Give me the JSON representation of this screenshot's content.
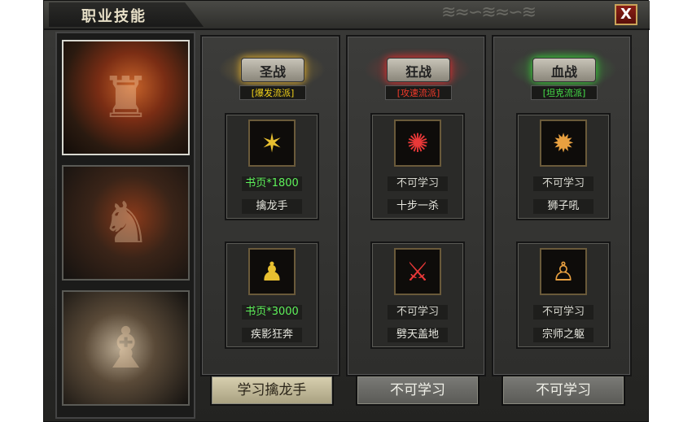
{
  "window": {
    "title": "职业技能",
    "close_label": "X"
  },
  "columns": [
    {
      "name": "圣战",
      "style": "[爆发流派]",
      "glow": "#e8b430",
      "style_color": "#f2d21a",
      "skills": [
        {
          "icon": "claw-icon",
          "cost": "书页*1800",
          "name": "擒龙手",
          "learnable": true
        },
        {
          "icon": "dash-icon",
          "cost": "书页*3000",
          "name": "疾影狂奔",
          "learnable": true
        }
      ],
      "button": "学习擒龙手"
    },
    {
      "name": "狂战",
      "style": "[攻速流派]",
      "glow": "#e83030",
      "style_color": "#f23a2a",
      "skills": [
        {
          "icon": "swirl-icon",
          "cost": "不可学习",
          "name": "十步一杀",
          "learnable": false
        },
        {
          "icon": "blade-icon",
          "cost": "不可学习",
          "name": "劈天盖地",
          "learnable": false
        }
      ],
      "button": "不可学习"
    },
    {
      "name": "血战",
      "style": "[坦克流派]",
      "glow": "#3ad83a",
      "style_color": "#46e24a",
      "skills": [
        {
          "icon": "burst-icon",
          "cost": "不可学习",
          "name": "狮子吼",
          "learnable": false
        },
        {
          "icon": "aura-icon",
          "cost": "不可学习",
          "name": "宗师之躯",
          "learnable": false
        }
      ],
      "button": "不可学习"
    }
  ]
}
